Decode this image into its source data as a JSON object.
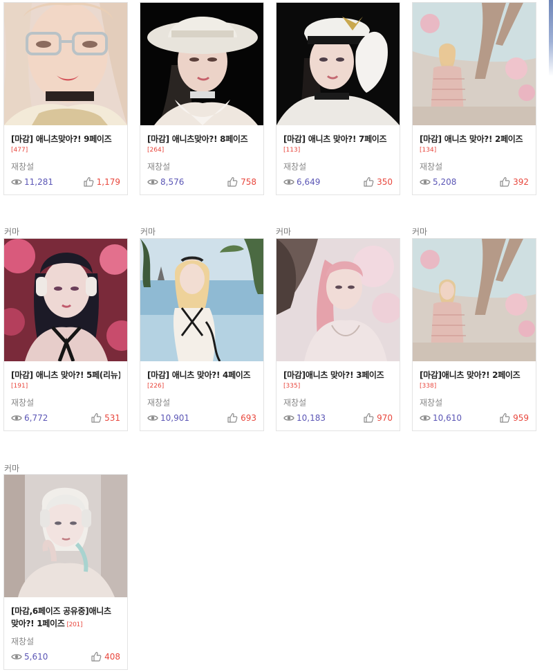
{
  "cards": [
    {
      "category": "",
      "title": "[마감] 애니츠맞아?! 9페이즈",
      "comments": "[477]",
      "author": "재창설",
      "views": "11,281",
      "likes": "1,179",
      "image": "girl-glasses-portrait"
    },
    {
      "category": "",
      "title": "[마감] 애니츠맞아?! 8페이즈",
      "comments": "[264]",
      "author": "재창설",
      "views": "8,576",
      "likes": "758",
      "image": "girl-white-sunhat-portrait"
    },
    {
      "category": "",
      "title": "[마감] 애니츠 맞아?! 7페이즈",
      "comments": "[113]",
      "author": "재창설",
      "views": "6,649",
      "likes": "350",
      "image": "girl-captain-hat-portrait"
    },
    {
      "category": "",
      "title": "[마감] 애니츠 맞아?! 2페이즈",
      "comments": "[134]",
      "author": "재창설",
      "views": "5,208",
      "likes": "392",
      "image": "girl-pink-dress-cherry-tree"
    },
    {
      "category": "커마",
      "title": "[마감] 애니츠 맞아?! 5페(리뉴)",
      "comments": "[191]",
      "author": "재창설",
      "views": "6,772",
      "likes": "531",
      "image": "girl-headphones-cherry-blossom"
    },
    {
      "category": "커마",
      "title": "[마감] 애니츠 맞아?! 4페이즈",
      "comments": "[226]",
      "author": "재창설",
      "views": "10,901",
      "likes": "693",
      "image": "girl-swimsuit-beach"
    },
    {
      "category": "커마",
      "title": "[마감]애니츠 맞아?! 3페이즈",
      "comments": "[335]",
      "author": "재창설",
      "views": "10,183",
      "likes": "970",
      "image": "girl-pink-hair-tree"
    },
    {
      "category": "커마",
      "title": "[마감]애니츠 맞아?! 2페이즈",
      "comments": "[338]",
      "author": "재창설",
      "views": "10,610",
      "likes": "959",
      "image": "girl-pink-dress-cherry-tree"
    },
    {
      "category": "커마",
      "title": "[마감,6페이즈 공유중]애니츠 맞아?! 1페이즈",
      "comments": "[201]",
      "author": "재창설",
      "views": "5,610",
      "likes": "408",
      "image": "girl-white-headphones"
    }
  ],
  "icons": {
    "views": "eye-icon",
    "likes": "thumbs-up-icon"
  },
  "colors": {
    "views": "#5a55b5",
    "likes": "#e8463c",
    "comments": "#e8463c",
    "author": "#888888",
    "border": "#e3e3e3"
  }
}
